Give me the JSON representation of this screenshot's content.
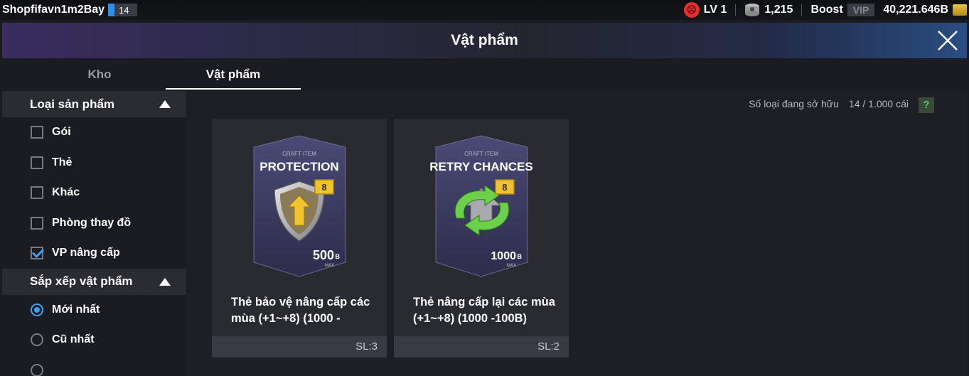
{
  "topbar": {
    "username": "Shopfifavn1m2Bay",
    "rank": "14",
    "level": "LV 1",
    "coins": "1,215",
    "boost_label": "Boost",
    "vip_label": "VIP",
    "bp": "40,221.646B"
  },
  "window": {
    "title": "Vật phẩm"
  },
  "tabs": [
    {
      "label": "Kho"
    },
    {
      "label": "Vật phẩm"
    }
  ],
  "filters": {
    "category_header": "Loại sản phẩm",
    "categories": [
      {
        "label": "Gói",
        "checked": false
      },
      {
        "label": "Thẻ",
        "checked": false
      },
      {
        "label": "Khác",
        "checked": false
      },
      {
        "label": "Phòng thay đồ",
        "checked": false
      },
      {
        "label": "VP nâng cấp",
        "checked": true
      }
    ],
    "sort_header": "Sắp xếp vật phẩm",
    "sort_options": [
      {
        "label": "Mới nhất",
        "selected": true
      },
      {
        "label": "Cũ nhất",
        "selected": false
      }
    ]
  },
  "owned": {
    "label": "Số loại đang sở hữu",
    "value": "14 / 1.000 cái",
    "help": "?"
  },
  "items": [
    {
      "craft_label": "CRAFT ITEM",
      "card_title": "PROTECTION",
      "level_badge": "8",
      "price": "500",
      "price_unit": "B",
      "price_sub": "MAX",
      "name_line1": "Thẻ bảo vệ nâng cấp các",
      "name_line2": "mùa (+1~+8) (1000 -",
      "qty": "SL:3"
    },
    {
      "craft_label": "CRAFT ITEM",
      "card_title": "RETRY CHANCES",
      "level_badge": "8",
      "price": "1000",
      "price_unit": "B",
      "price_sub": "MAX",
      "name_line1": "Thẻ nâng cấp lại các mùa",
      "name_line2": "(+1~+8) (1000 -100B)",
      "qty": "SL:2"
    }
  ]
}
